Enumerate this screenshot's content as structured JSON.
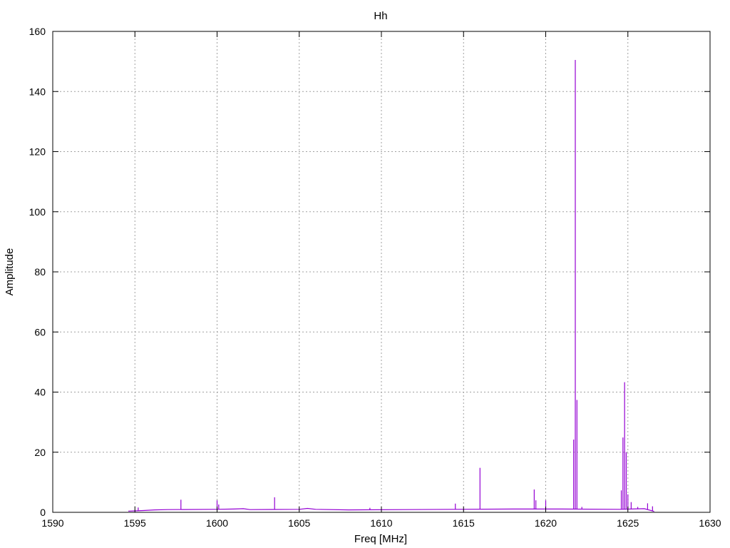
{
  "chart_data": {
    "type": "line",
    "title": "Hh",
    "xlabel": "Freq [MHz]",
    "ylabel": "Amplitude",
    "xlim": [
      1590,
      1630
    ],
    "ylim": [
      0,
      160
    ],
    "xticks": [
      1590,
      1595,
      1600,
      1605,
      1610,
      1615,
      1620,
      1625,
      1630
    ],
    "yticks": [
      0,
      20,
      40,
      60,
      80,
      100,
      120,
      140,
      160
    ],
    "grid": true,
    "line_color": "#9400d3",
    "baseline": [
      [
        1594.6,
        0.4
      ],
      [
        1595.5,
        0.6
      ],
      [
        1596.2,
        0.8
      ],
      [
        1597.0,
        0.9
      ],
      [
        1599.9,
        1.0
      ],
      [
        1601.0,
        1.1
      ],
      [
        1601.6,
        1.2
      ],
      [
        1602.0,
        0.9
      ],
      [
        1605.0,
        1.0
      ],
      [
        1605.5,
        1.3
      ],
      [
        1606.0,
        1.0
      ],
      [
        1608.0,
        0.8
      ],
      [
        1611.5,
        0.9
      ],
      [
        1614.5,
        1.0
      ],
      [
        1618.0,
        1.1
      ],
      [
        1621.0,
        1.1
      ],
      [
        1624.5,
        1.0
      ],
      [
        1626.0,
        1.2
      ],
      [
        1626.6,
        0.3
      ]
    ],
    "peaks": [
      {
        "x": 1595.2,
        "y": 1.6
      },
      {
        "x": 1597.8,
        "y": 4.2
      },
      {
        "x": 1600.0,
        "y": 4.0
      },
      {
        "x": 1600.1,
        "y": 2.6
      },
      {
        "x": 1603.5,
        "y": 5.0
      },
      {
        "x": 1609.3,
        "y": 1.5
      },
      {
        "x": 1614.5,
        "y": 2.9
      },
      {
        "x": 1616.0,
        "y": 14.8
      },
      {
        "x": 1619.3,
        "y": 7.6
      },
      {
        "x": 1619.4,
        "y": 4.0
      },
      {
        "x": 1620.0,
        "y": 4.0
      },
      {
        "x": 1621.7,
        "y": 24.2
      },
      {
        "x": 1621.8,
        "y": 150.5
      },
      {
        "x": 1621.9,
        "y": 37.4
      },
      {
        "x": 1622.2,
        "y": 1.8
      },
      {
        "x": 1624.6,
        "y": 7.3
      },
      {
        "x": 1624.7,
        "y": 24.9
      },
      {
        "x": 1624.8,
        "y": 43.3
      },
      {
        "x": 1624.9,
        "y": 20.0
      },
      {
        "x": 1625.0,
        "y": 6.0
      },
      {
        "x": 1625.2,
        "y": 3.4
      },
      {
        "x": 1625.6,
        "y": 1.8
      },
      {
        "x": 1626.2,
        "y": 3.0
      },
      {
        "x": 1626.5,
        "y": 2.0
      }
    ]
  }
}
